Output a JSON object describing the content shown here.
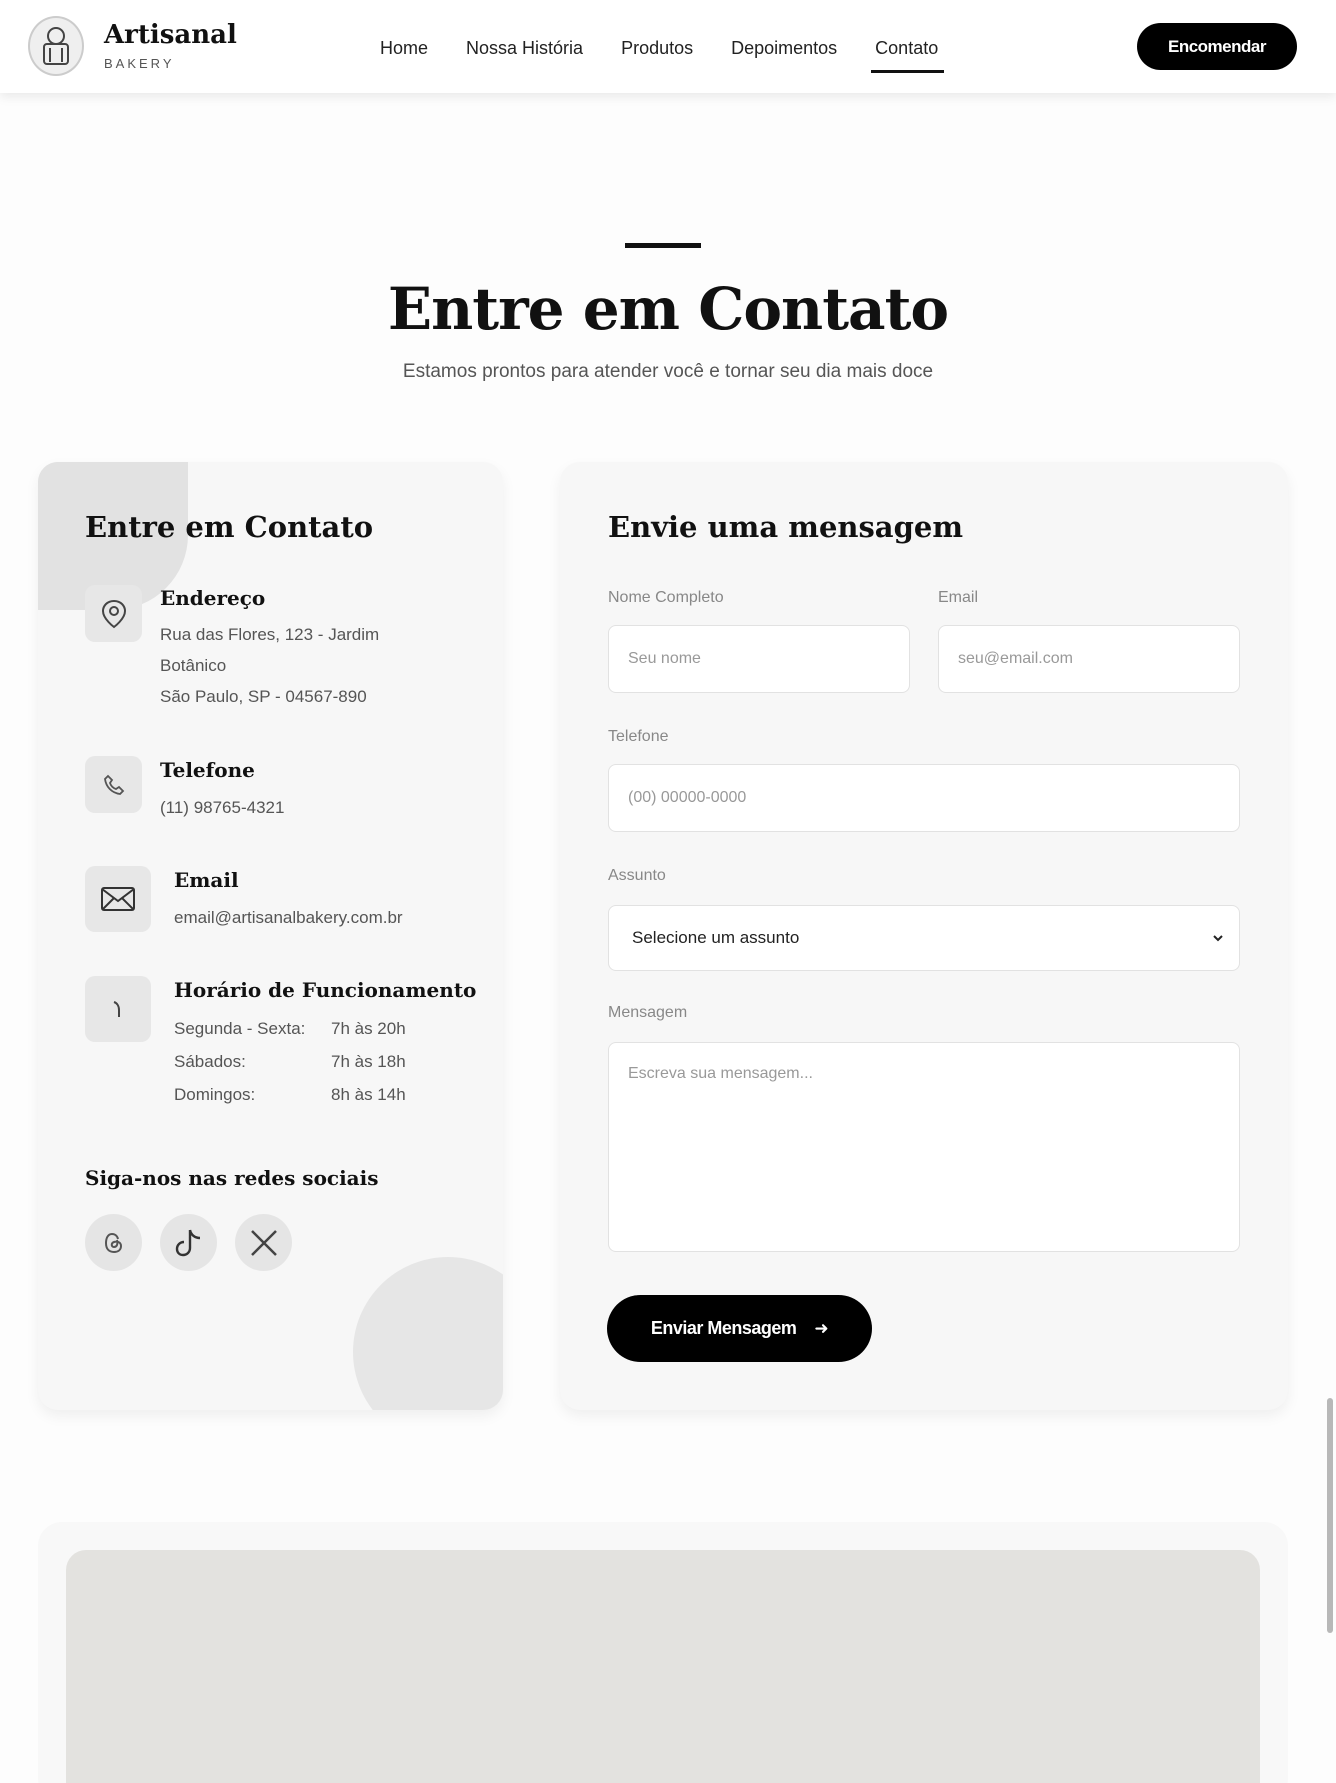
{
  "nav": {
    "brand_name": "Artisanal",
    "brand_sub": "BAKERY",
    "links": [
      "Home",
      "Nossa História",
      "Produtos",
      "Depoimentos",
      "Contato"
    ],
    "active_link": "Contato",
    "cta_label": "Encomendar"
  },
  "section": {
    "title": "Entre em Contato",
    "subtitle": "Estamos prontos para atender você e tornar seu dia mais doce"
  },
  "info_card": {
    "title": "Entre em Contato",
    "address": {
      "label": "Endereço",
      "line1": "Rua das Flores, 123 - Jardim",
      "line2": "Botânico",
      "line3": "São Paulo, SP - 04567-890"
    },
    "phone": {
      "label": "Telefone",
      "value": "(11) 98765-4321"
    },
    "email": {
      "label": "Email",
      "value": "email@artisanalbakery.com.br"
    },
    "hours": {
      "label": "Horário de Funcionamento",
      "rows": [
        {
          "day": "Segunda - Sexta:",
          "time": "7h às 20h"
        },
        {
          "day": "Sábados:",
          "time": "7h às 18h"
        },
        {
          "day": "Domingos:",
          "time": "8h às 14h"
        }
      ]
    },
    "social_title": "Siga-nos nas redes sociais",
    "social_icons": [
      "threads-icon",
      "tiktok-icon",
      "x-icon"
    ]
  },
  "form": {
    "title": "Envie uma mensagem",
    "name_label": "Nome Completo",
    "name_placeholder": "Seu nome",
    "email_label": "Email",
    "email_placeholder": "seu@email.com",
    "phone_label": "Telefone",
    "phone_placeholder": "(00) 00000-0000",
    "subject_label": "Assunto",
    "subject_selected": "Selecione um assunto",
    "message_label": "Mensagem",
    "message_placeholder": "Escreva sua mensagem...",
    "submit_label": "Enviar Mensagem",
    "submit_icon": "arrow-right-icon"
  },
  "colors": {
    "accent": "#000000",
    "card_bg": "#f7f7f7",
    "icon_bg": "#e7e7e7",
    "map_bg": "#e3e2df"
  }
}
